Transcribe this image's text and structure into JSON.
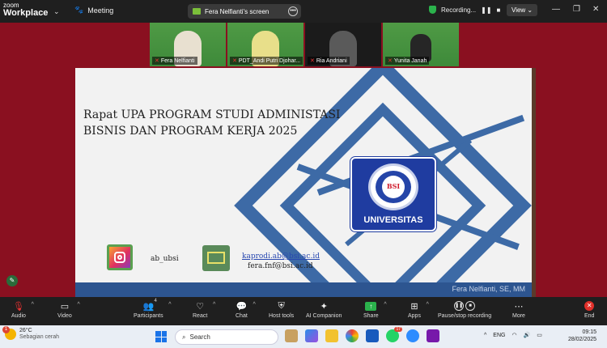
{
  "window": {
    "app_line1": "zoom",
    "app_line2": "Workplace",
    "meeting_label": "Meeting",
    "screen_share_label": "Fera Nelfianti's screen",
    "recording_label": "Recording...",
    "view_label": "View"
  },
  "participants": [
    {
      "name": "Fera Nelfianti",
      "video_on": true
    },
    {
      "name": "PDT_Andi Putri Djohar...",
      "video_on": true
    },
    {
      "name": "Ria Andriani",
      "video_on": false
    },
    {
      "name": "Yunita Janah",
      "video_on": true
    }
  ],
  "slide": {
    "title_line1": "Rapat UPA PROGRAM STUDI ADMINISTASI",
    "title_line2": "BISNIS DAN PROGRAM KERJA 2025",
    "logo_text": "BSI",
    "logo_label": "UNIVERSITAS",
    "instagram_handle": "ab_ubsi",
    "email1": "kaprodi.ab@bsi.ac.id",
    "email2": "fera.fnf@bsi.ac.id",
    "footer_text": "Fera Nelfianti, SE, MM"
  },
  "toolbar": {
    "audio": "Audio",
    "video": "Video",
    "participants": "Participants",
    "participants_count": "4",
    "react": "React",
    "chat": "Chat",
    "host_tools": "Host tools",
    "ai_companion": "AI Companion",
    "share": "Share",
    "apps": "Apps",
    "pause_recording": "Pause/stop recording",
    "more": "More",
    "end": "End"
  },
  "taskbar": {
    "temp": "26°C",
    "weather": "Sebagian cerah",
    "weather_badge": "1",
    "search_placeholder": "Search",
    "whatsapp_badge": "17",
    "lang": "ENG",
    "time": "09:15",
    "date": "28/02/2025"
  },
  "colors": {
    "accent_blue": "#3d6aa6",
    "zoom_bg": "#1f1f1f",
    "share_green": "#2bb24c",
    "end_red": "#e0302a"
  }
}
